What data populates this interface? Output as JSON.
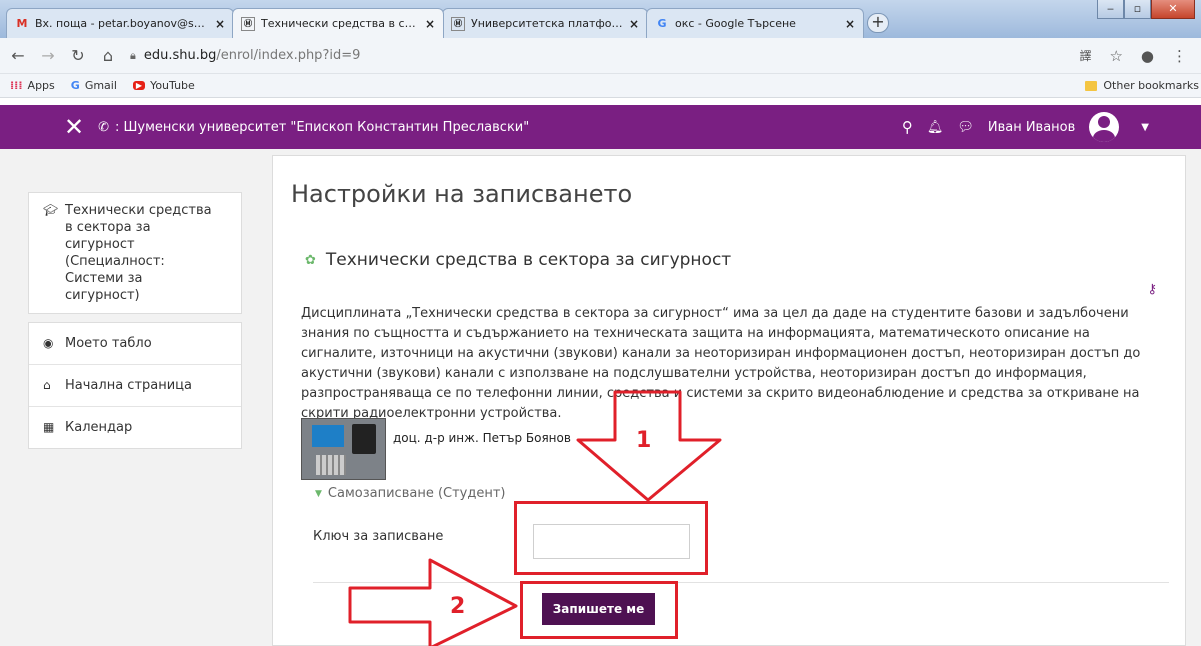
{
  "browser": {
    "tabs": [
      {
        "label": "Вх. поща - petar.boyanov@shu.b",
        "favicon": "gmail-icon",
        "active": false
      },
      {
        "label": "Технически средства в сектора",
        "favicon": "moodle-icon",
        "active": true
      },
      {
        "label": "Университетска платформа за с",
        "favicon": "moodle-icon",
        "active": false
      },
      {
        "label": "окс - Google Търсене",
        "favicon": "google-icon",
        "active": false
      }
    ],
    "new_tab": "+",
    "url_host": "edu.shu.bg",
    "url_path": "/enrol/index.php?id=9",
    "bookmarks": [
      "Apps",
      "Gmail",
      "YouTube"
    ],
    "other_bookmarks": "Other bookmarks"
  },
  "navbar": {
    "site_name": ": Шуменски университет \"Епископ Константин Преславски\"",
    "user_name": "Иван Иванов"
  },
  "sidebar": {
    "course": "Технически средства в сектора за сигурност (Специалност: Системи за сигурност)",
    "items": [
      {
        "label": "Моето табло",
        "icon": "dashboard-icon"
      },
      {
        "label": "Начална страница",
        "icon": "home-icon"
      },
      {
        "label": "Календар",
        "icon": "calendar-icon"
      }
    ]
  },
  "main": {
    "page_title": "Настройки на записването",
    "course_title": "Технически средства в сектора за сигурност",
    "summary": "Дисциплината „Технически средства в сектора за сигурност“ има за цел да даде на студентите базови и задълбочени знания по същността и съдържанието на техническата защита на информацията, математическото описание на сигналите, източници на акустични (звукови) канали за неоторизиран информационен достъп, неоторизиран достъп до акустични (звукови) канали с използване на подслушвателни устройства, неоторизиран достъп до информация, разпространяваща се по телефонни линии, средства и системи за скрито видеонаблюдение и средства за откриване на скрити радиоелектронни устройства.",
    "teacher": "доц. д-р инж. Петър Боянов",
    "section": "Самозаписване (Студент)",
    "enrol_key_label": "Ключ за записване",
    "enrol_key_value": "",
    "submit_label": "Запишете ме"
  },
  "annotations": {
    "step1": "1",
    "step2": "2",
    "color": "#e0202a"
  },
  "colors": {
    "navbar": "#7a1f82",
    "button": "#4e1152"
  }
}
